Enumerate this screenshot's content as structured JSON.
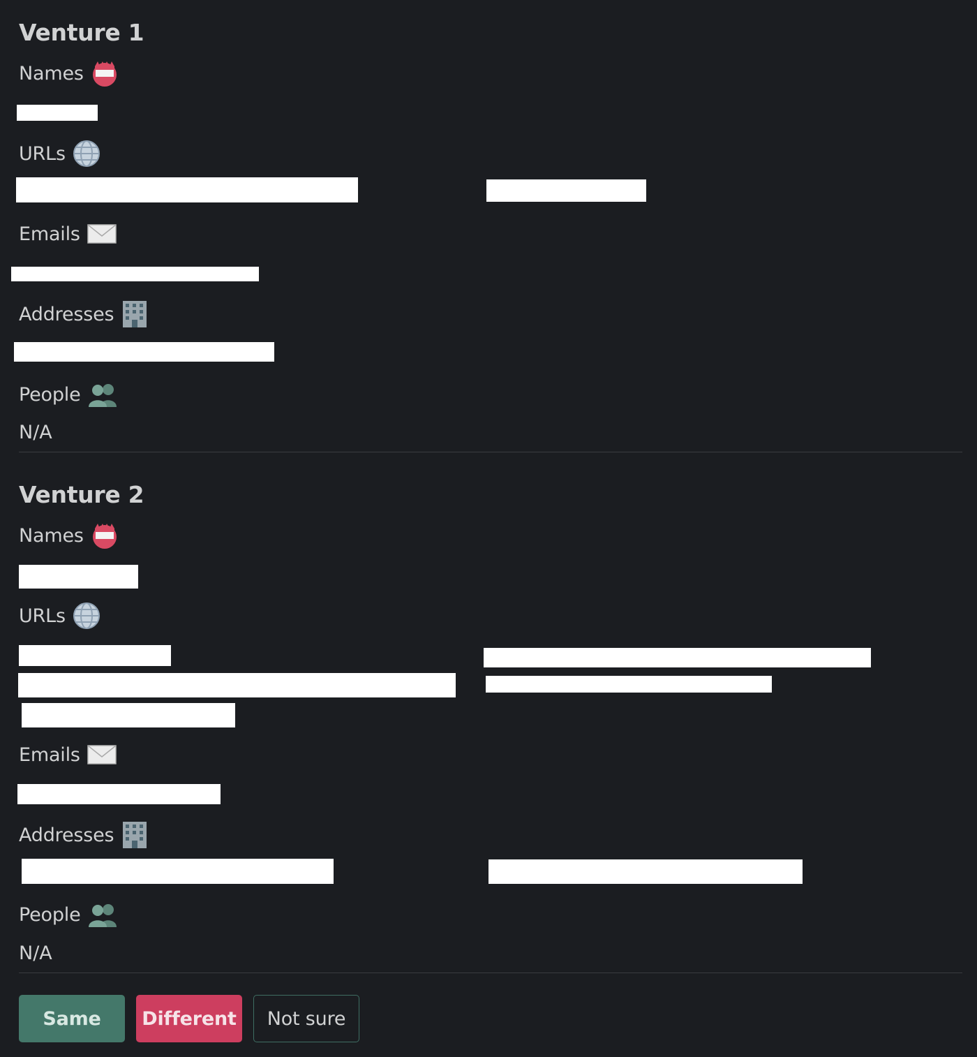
{
  "ventures": [
    {
      "title": "Venture 1",
      "names_label": "Names",
      "urls_label": "URLs",
      "emails_label": "Emails",
      "addresses_label": "Addresses",
      "people_label": "People",
      "people_value": "N/A"
    },
    {
      "title": "Venture 2",
      "names_label": "Names",
      "urls_label": "URLs",
      "emails_label": "Emails",
      "addresses_label": "Addresses",
      "people_label": "People",
      "people_value": "N/A"
    }
  ],
  "icons": {
    "names": "name-badge-icon",
    "urls": "globe-icon",
    "emails": "envelope-icon",
    "addresses": "office-building-icon",
    "people": "busts-in-silhouette-icon"
  },
  "actions": {
    "same_label": "Same",
    "different_label": "Different",
    "not_sure_label": "Not sure"
  },
  "colors": {
    "background": "#1b1d21",
    "text": "#d1d2d3",
    "same": "#44786a",
    "different": "#cd3e5f",
    "not_sure_border": "#3f6e63",
    "redaction": "#ffffff"
  }
}
